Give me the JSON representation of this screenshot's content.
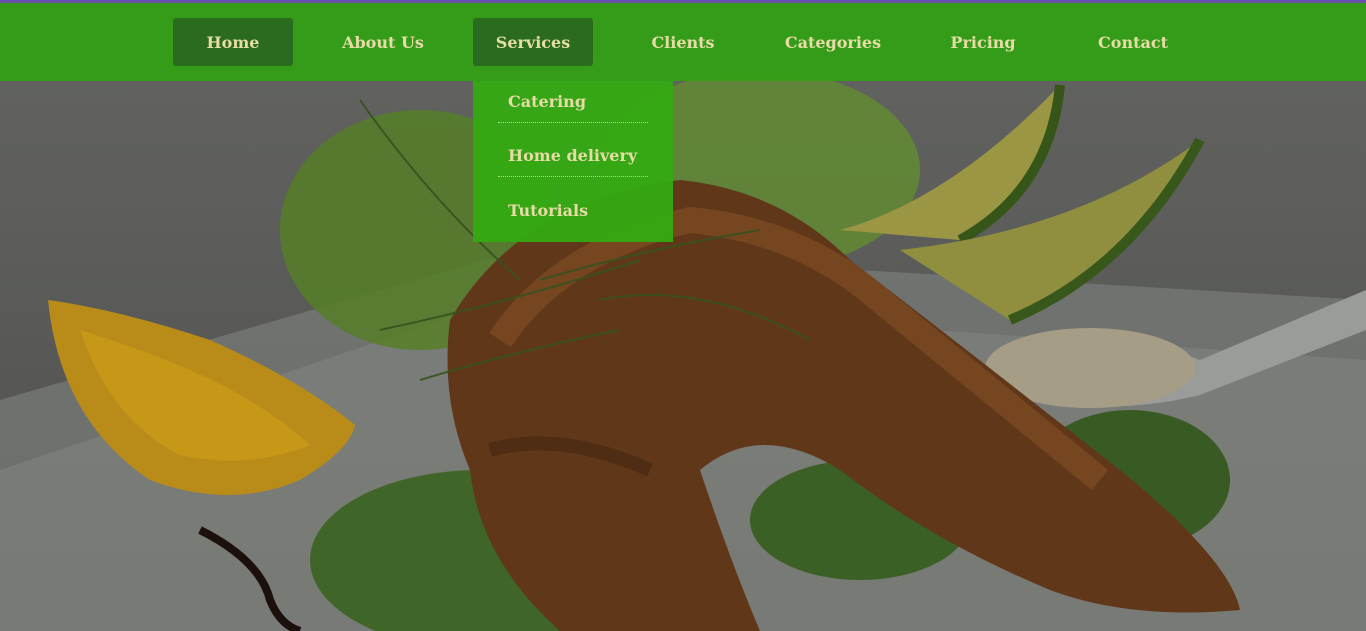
{
  "nav": {
    "items": [
      {
        "label": "Home"
      },
      {
        "label": "About Us"
      },
      {
        "label": "Services"
      },
      {
        "label": "Clients"
      },
      {
        "label": "Categories"
      },
      {
        "label": "Pricing"
      },
      {
        "label": "Contact"
      }
    ],
    "active_items": [
      "Home",
      "Services"
    ]
  },
  "services_dropdown": {
    "items": [
      {
        "label": "Catering"
      },
      {
        "label": "Home delivery"
      },
      {
        "label": "Tutorials"
      }
    ]
  },
  "colors": {
    "navbar": "#349e17",
    "active_tab": "#2a6b1e",
    "dropdown": "#34aa12",
    "text": "#e6dca6",
    "top_border": "#6a4fa8"
  }
}
